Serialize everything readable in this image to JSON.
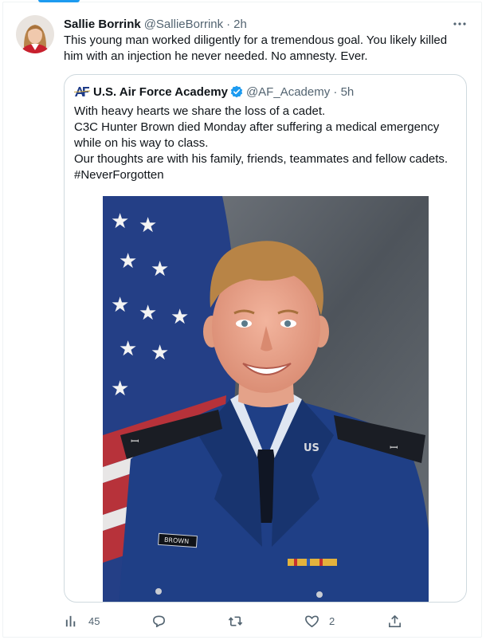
{
  "tweet": {
    "author_name": "Sallie Borrink",
    "handle": "@SallieBorrink",
    "time": "2h",
    "text_lines": [
      "This young man worked diligently for a tremendous goal. You likely killed",
      "him with an injection he never needed. No amnesty. Ever."
    ]
  },
  "quoted": {
    "author_name": "U.S. Air Force Academy",
    "handle": "@AF_Academy",
    "time": "5h",
    "logo_text": "AF",
    "lines": [
      "With heavy hearts we share the loss of a cadet.",
      "C3C Hunter Brown died Monday after suffering a medical emergency",
      "while on his way to class.",
      "Our thoughts are with his family, friends, teammates and fellow cadets.",
      "#NeverForgotten"
    ],
    "photo": {
      "name_tag": "BROWN",
      "insignia": "US"
    }
  },
  "actions": {
    "views": "45",
    "likes": "2"
  },
  "icons": {
    "more": "more-dots-icon",
    "reply": "reply-icon",
    "retweet": "retweet-icon",
    "like": "like-icon",
    "share": "share-icon",
    "analytics": "analytics-icon",
    "verified": "verified-badge-icon"
  },
  "colors": {
    "accent": "#1d9bf0",
    "text": "#0f1419",
    "muted": "#536471",
    "border": "#cfd9de"
  }
}
